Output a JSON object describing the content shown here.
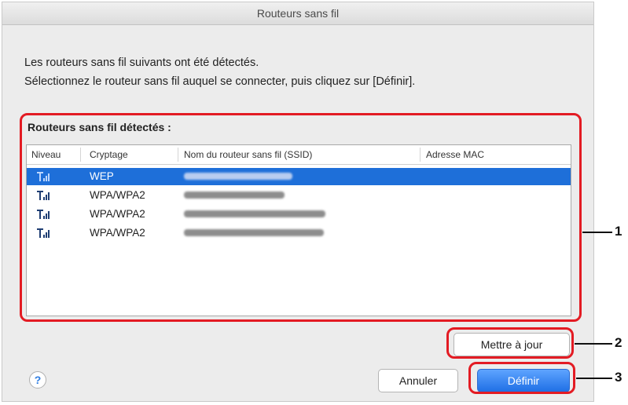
{
  "window": {
    "title": "Routeurs sans fil"
  },
  "message": {
    "line1": "Les routeurs sans fil suivants ont été détectés.",
    "line2": "Sélectionnez le routeur sans fil auquel se connecter, puis cliquez sur [Définir]."
  },
  "group": {
    "label": "Routeurs sans fil détectés :"
  },
  "table": {
    "columns": [
      "Niveau",
      "Cryptage",
      "Nom du routeur sans fil (SSID)",
      "Adresse MAC"
    ],
    "rows": [
      {
        "level_icon": "wifi-signal-icon",
        "encryption": "WEP",
        "ssid": "",
        "mac": "",
        "selected": true
      },
      {
        "level_icon": "wifi-signal-icon",
        "encryption": "WPA/WPA2",
        "ssid": "",
        "mac": "",
        "selected": false
      },
      {
        "level_icon": "wifi-signal-icon",
        "encryption": "WPA/WPA2",
        "ssid": "",
        "mac": "",
        "selected": false
      },
      {
        "level_icon": "wifi-signal-icon",
        "encryption": "WPA/WPA2",
        "ssid": "",
        "mac": "",
        "selected": false
      }
    ]
  },
  "buttons": {
    "update": "Mettre à jour",
    "cancel": "Annuler",
    "set": "Définir",
    "help": "?"
  },
  "callouts": {
    "one": "1",
    "two": "2",
    "three": "3"
  },
  "colors": {
    "callout": "#e31b23",
    "selection": "#1e6fd9",
    "accent": "#2f7de1"
  }
}
